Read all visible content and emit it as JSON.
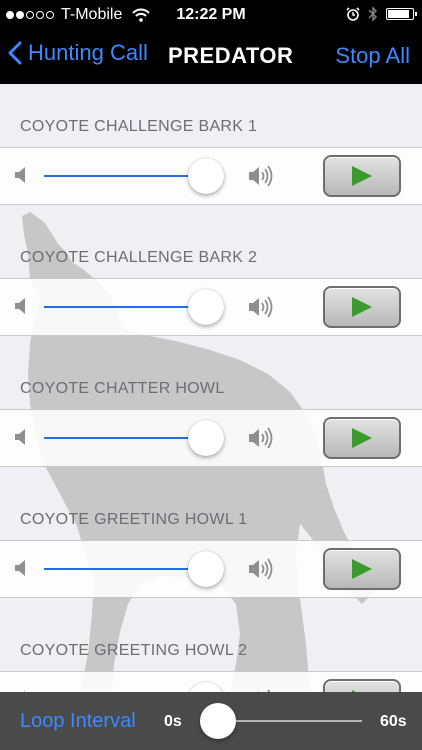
{
  "status_bar": {
    "carrier": "T-Mobile",
    "time": "12:22 PM",
    "signal_bars_filled": 2,
    "signal_bars_total": 5,
    "battery_level": 0.9
  },
  "nav": {
    "back_label": "Hunting Call",
    "title": "PREDATOR",
    "right_button": "Stop All"
  },
  "sounds": [
    {
      "title": "COYOTE CHALLENGE BARK 1",
      "volume": 0.95
    },
    {
      "title": "COYOTE CHALLENGE BARK 2",
      "volume": 0.95
    },
    {
      "title": "COYOTE CHATTER HOWL",
      "volume": 0.95
    },
    {
      "title": "COYOTE GREETING HOWL 1",
      "volume": 0.95
    },
    {
      "title": "COYOTE GREETING HOWL 2",
      "volume": 0.95
    }
  ],
  "loop": {
    "label": "Loop Interval",
    "min_label": "0s",
    "max_label": "60s",
    "value": 0
  },
  "colors": {
    "accent": "#3c8aff",
    "slider_fill": "#1f6fe8",
    "play_icon": "#3a9a2e"
  }
}
